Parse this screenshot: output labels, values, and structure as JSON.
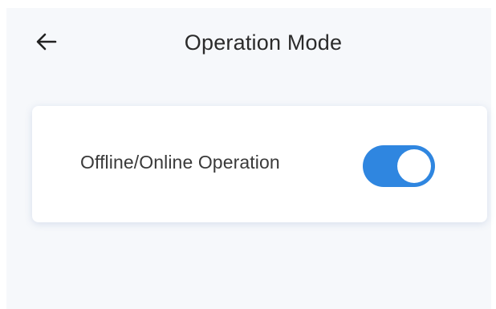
{
  "header": {
    "title": "Operation Mode",
    "back_icon": "arrow-left-icon"
  },
  "settings": {
    "offline_online": {
      "label": "Offline/Online Operation",
      "enabled": true
    }
  },
  "colors": {
    "accent": "#2f86e0",
    "background": "#f6f8fb",
    "card": "#ffffff",
    "text": "#2b2b2b"
  }
}
